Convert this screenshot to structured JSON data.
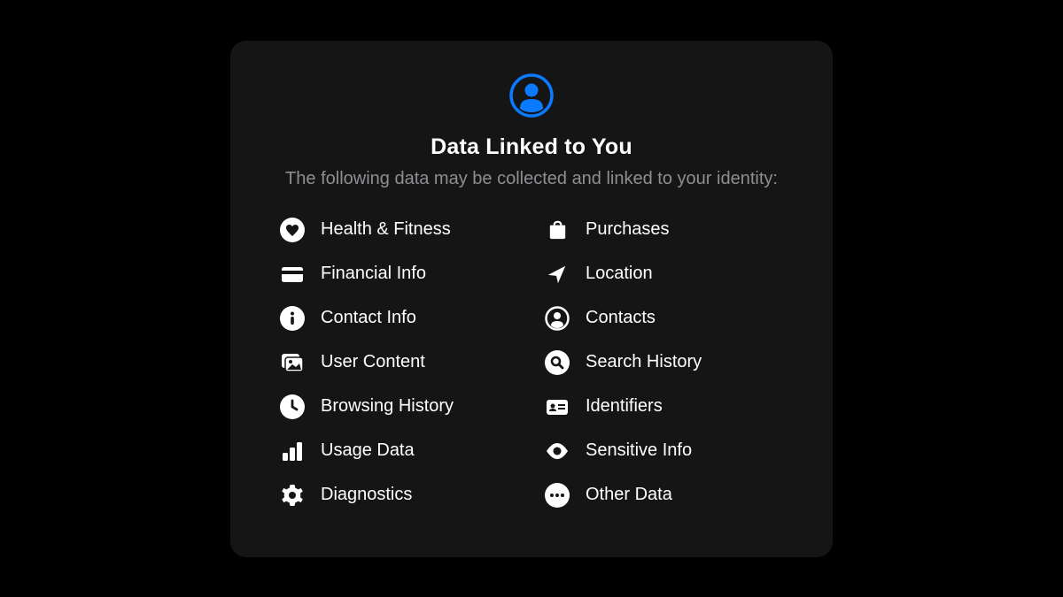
{
  "colors": {
    "accent": "#0a7aff",
    "icon": "#ffffff",
    "card_bg": "#151515",
    "text": "#ffffff",
    "subtext": "#8e8e93"
  },
  "header": {
    "title": "Data Linked to You",
    "subtitle": "The following data may be collected and linked to your identity:"
  },
  "items": {
    "left": [
      {
        "icon": "heart-circle-icon",
        "label": "Health & Fitness"
      },
      {
        "icon": "credit-card-icon",
        "label": "Financial Info"
      },
      {
        "icon": "info-circle-icon",
        "label": "Contact Info"
      },
      {
        "icon": "photo-stack-icon",
        "label": "User Content"
      },
      {
        "icon": "clock-icon",
        "label": "Browsing History"
      },
      {
        "icon": "bar-chart-icon",
        "label": "Usage Data"
      },
      {
        "icon": "gear-icon",
        "label": "Diagnostics"
      }
    ],
    "right": [
      {
        "icon": "bag-icon",
        "label": "Purchases"
      },
      {
        "icon": "location-arrow-icon",
        "label": "Location"
      },
      {
        "icon": "person-circle-icon",
        "label": "Contacts"
      },
      {
        "icon": "search-circle-icon",
        "label": "Search History"
      },
      {
        "icon": "id-card-icon",
        "label": "Identifiers"
      },
      {
        "icon": "eye-icon",
        "label": "Sensitive Info"
      },
      {
        "icon": "ellipsis-circle-icon",
        "label": "Other Data"
      }
    ]
  }
}
